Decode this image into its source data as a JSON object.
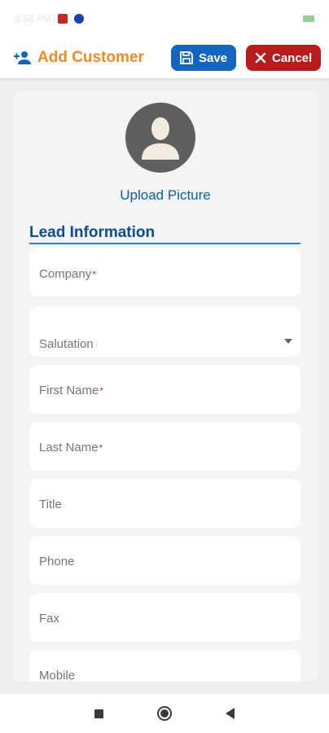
{
  "status_bar": {
    "time": "9:58 PM"
  },
  "header": {
    "title": "Add Customer",
    "save_label": "Save",
    "cancel_label": "Cancel"
  },
  "profile": {
    "upload_label": "Upload Picture"
  },
  "section": {
    "title": "Lead Information"
  },
  "fields": [
    {
      "label": "Company",
      "required": "*"
    },
    {
      "label": "Salutation",
      "required": ""
    },
    {
      "label": "First Name",
      "required": "*"
    },
    {
      "label": "Last Name",
      "required": "*"
    },
    {
      "label": "Title",
      "required": ""
    },
    {
      "label": "Phone",
      "required": ""
    },
    {
      "label": "Fax",
      "required": ""
    },
    {
      "label": "Mobile",
      "required": ""
    }
  ],
  "colors": {
    "title_orange": "#f08a24",
    "save_blue": "#1565c0",
    "cancel_red": "#b71c1c",
    "section_blue": "#0f4c8a"
  }
}
